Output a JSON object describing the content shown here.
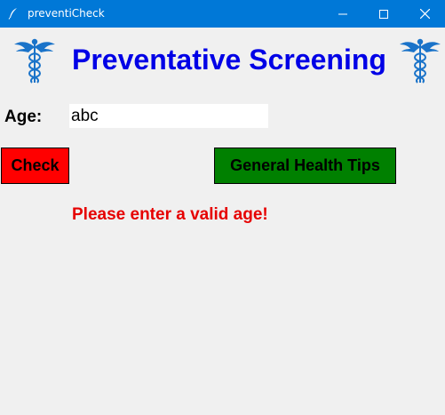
{
  "window": {
    "title": "preventiCheck",
    "titlebar_color": "#0078d7"
  },
  "header": {
    "title": "Preventative Screening",
    "title_color": "#0000e6",
    "logo_icon": "caduceus-icon"
  },
  "form": {
    "age_label": "Age:",
    "age_value": "abc"
  },
  "buttons": {
    "check_label": "Check",
    "check_color": "#ff0000",
    "tips_label": "General Health Tips",
    "tips_color": "#008000"
  },
  "status": {
    "error_message": "Please enter a valid age!",
    "error_color": "#e60000"
  }
}
